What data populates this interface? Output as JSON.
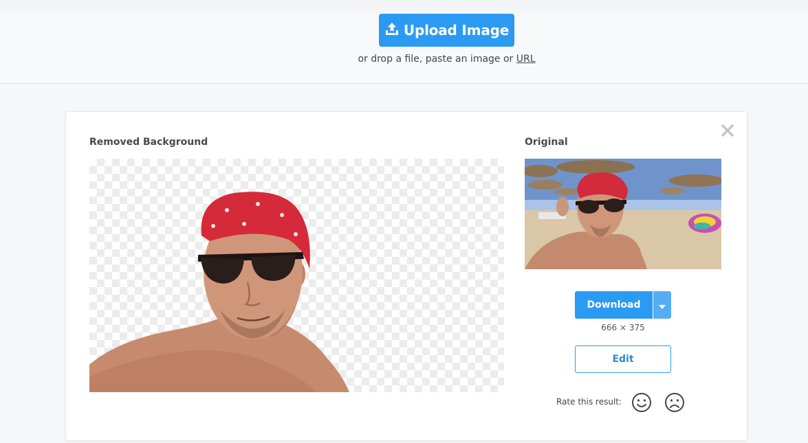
{
  "header": {
    "upload_button_label": "Upload Image",
    "upload_icon": "upload-icon",
    "drop_text_prefix": "or drop a file, paste an image or",
    "drop_text_link": "URL"
  },
  "result_card": {
    "close_icon": "close-icon",
    "removed_background_title": "Removed Background",
    "original_title": "Original",
    "download_label": "Download",
    "dropdown_icon": "caret-down-icon",
    "dimensions": "666 × 375",
    "edit_label": "Edit",
    "rate_label": "Rate this result:",
    "rate_positive_icon": "smile-icon",
    "rate_negative_icon": "frown-icon"
  },
  "colors": {
    "accent": "#2b9af3",
    "accent_light": "#55aef5",
    "page_background": "#f6f7f9",
    "card_background": "#ffffff"
  }
}
